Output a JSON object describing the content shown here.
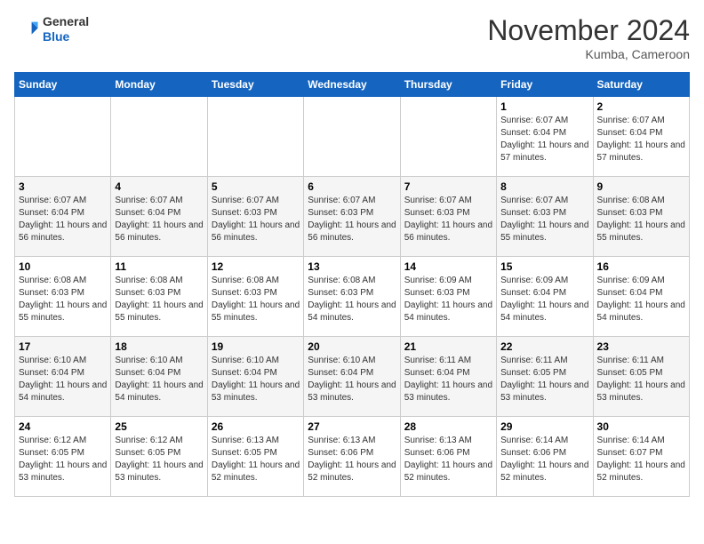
{
  "header": {
    "logo_line1": "General",
    "logo_line2": "Blue",
    "month": "November 2024",
    "location": "Kumba, Cameroon"
  },
  "days_of_week": [
    "Sunday",
    "Monday",
    "Tuesday",
    "Wednesday",
    "Thursday",
    "Friday",
    "Saturday"
  ],
  "weeks": [
    [
      {
        "day": "",
        "info": ""
      },
      {
        "day": "",
        "info": ""
      },
      {
        "day": "",
        "info": ""
      },
      {
        "day": "",
        "info": ""
      },
      {
        "day": "",
        "info": ""
      },
      {
        "day": "1",
        "info": "Sunrise: 6:07 AM\nSunset: 6:04 PM\nDaylight: 11 hours and 57 minutes."
      },
      {
        "day": "2",
        "info": "Sunrise: 6:07 AM\nSunset: 6:04 PM\nDaylight: 11 hours and 57 minutes."
      }
    ],
    [
      {
        "day": "3",
        "info": "Sunrise: 6:07 AM\nSunset: 6:04 PM\nDaylight: 11 hours and 56 minutes."
      },
      {
        "day": "4",
        "info": "Sunrise: 6:07 AM\nSunset: 6:04 PM\nDaylight: 11 hours and 56 minutes."
      },
      {
        "day": "5",
        "info": "Sunrise: 6:07 AM\nSunset: 6:03 PM\nDaylight: 11 hours and 56 minutes."
      },
      {
        "day": "6",
        "info": "Sunrise: 6:07 AM\nSunset: 6:03 PM\nDaylight: 11 hours and 56 minutes."
      },
      {
        "day": "7",
        "info": "Sunrise: 6:07 AM\nSunset: 6:03 PM\nDaylight: 11 hours and 56 minutes."
      },
      {
        "day": "8",
        "info": "Sunrise: 6:07 AM\nSunset: 6:03 PM\nDaylight: 11 hours and 55 minutes."
      },
      {
        "day": "9",
        "info": "Sunrise: 6:08 AM\nSunset: 6:03 PM\nDaylight: 11 hours and 55 minutes."
      }
    ],
    [
      {
        "day": "10",
        "info": "Sunrise: 6:08 AM\nSunset: 6:03 PM\nDaylight: 11 hours and 55 minutes."
      },
      {
        "day": "11",
        "info": "Sunrise: 6:08 AM\nSunset: 6:03 PM\nDaylight: 11 hours and 55 minutes."
      },
      {
        "day": "12",
        "info": "Sunrise: 6:08 AM\nSunset: 6:03 PM\nDaylight: 11 hours and 55 minutes."
      },
      {
        "day": "13",
        "info": "Sunrise: 6:08 AM\nSunset: 6:03 PM\nDaylight: 11 hours and 54 minutes."
      },
      {
        "day": "14",
        "info": "Sunrise: 6:09 AM\nSunset: 6:03 PM\nDaylight: 11 hours and 54 minutes."
      },
      {
        "day": "15",
        "info": "Sunrise: 6:09 AM\nSunset: 6:04 PM\nDaylight: 11 hours and 54 minutes."
      },
      {
        "day": "16",
        "info": "Sunrise: 6:09 AM\nSunset: 6:04 PM\nDaylight: 11 hours and 54 minutes."
      }
    ],
    [
      {
        "day": "17",
        "info": "Sunrise: 6:10 AM\nSunset: 6:04 PM\nDaylight: 11 hours and 54 minutes."
      },
      {
        "day": "18",
        "info": "Sunrise: 6:10 AM\nSunset: 6:04 PM\nDaylight: 11 hours and 54 minutes."
      },
      {
        "day": "19",
        "info": "Sunrise: 6:10 AM\nSunset: 6:04 PM\nDaylight: 11 hours and 53 minutes."
      },
      {
        "day": "20",
        "info": "Sunrise: 6:10 AM\nSunset: 6:04 PM\nDaylight: 11 hours and 53 minutes."
      },
      {
        "day": "21",
        "info": "Sunrise: 6:11 AM\nSunset: 6:04 PM\nDaylight: 11 hours and 53 minutes."
      },
      {
        "day": "22",
        "info": "Sunrise: 6:11 AM\nSunset: 6:05 PM\nDaylight: 11 hours and 53 minutes."
      },
      {
        "day": "23",
        "info": "Sunrise: 6:11 AM\nSunset: 6:05 PM\nDaylight: 11 hours and 53 minutes."
      }
    ],
    [
      {
        "day": "24",
        "info": "Sunrise: 6:12 AM\nSunset: 6:05 PM\nDaylight: 11 hours and 53 minutes."
      },
      {
        "day": "25",
        "info": "Sunrise: 6:12 AM\nSunset: 6:05 PM\nDaylight: 11 hours and 53 minutes."
      },
      {
        "day": "26",
        "info": "Sunrise: 6:13 AM\nSunset: 6:05 PM\nDaylight: 11 hours and 52 minutes."
      },
      {
        "day": "27",
        "info": "Sunrise: 6:13 AM\nSunset: 6:06 PM\nDaylight: 11 hours and 52 minutes."
      },
      {
        "day": "28",
        "info": "Sunrise: 6:13 AM\nSunset: 6:06 PM\nDaylight: 11 hours and 52 minutes."
      },
      {
        "day": "29",
        "info": "Sunrise: 6:14 AM\nSunset: 6:06 PM\nDaylight: 11 hours and 52 minutes."
      },
      {
        "day": "30",
        "info": "Sunrise: 6:14 AM\nSunset: 6:07 PM\nDaylight: 11 hours and 52 minutes."
      }
    ]
  ]
}
